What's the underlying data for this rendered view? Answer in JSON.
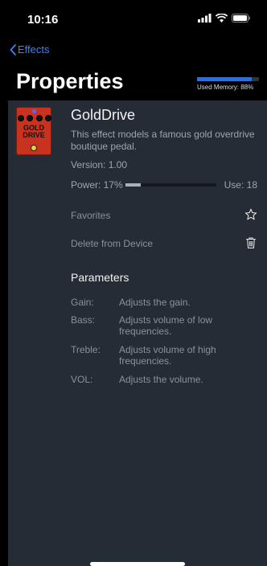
{
  "status": {
    "time": "10:16"
  },
  "nav": {
    "back_label": "Effects"
  },
  "page": {
    "title": "Properties"
  },
  "memory": {
    "label": "Used Memory: 88%",
    "fraction": 0.88
  },
  "effect": {
    "name": "GoldDrive",
    "description": "This effect models a famous gold overdrive boutique pedal.",
    "version": "Version: 1.00",
    "power_label": "Power: 17%",
    "power_fraction": 0.17,
    "use_label": "Use: 18",
    "pedal_text_line1": "GOLD",
    "pedal_text_line2": "DRIVE"
  },
  "actions": {
    "favorites_label": "Favorites",
    "delete_label": "Delete from Device"
  },
  "parameters": {
    "heading": "Parameters",
    "items": [
      {
        "name": "Gain:",
        "description": "Adjusts the gain."
      },
      {
        "name": "Bass:",
        "description": "Adjusts volume of low frequencies."
      },
      {
        "name": "Treble:",
        "description": "Adjusts volume of high frequencies."
      },
      {
        "name": "VOL:",
        "description": "Adjusts the volume."
      }
    ]
  },
  "colors": {
    "accent": "#3b82f6",
    "panel": "#262c35",
    "pedal": "#c9321f"
  }
}
